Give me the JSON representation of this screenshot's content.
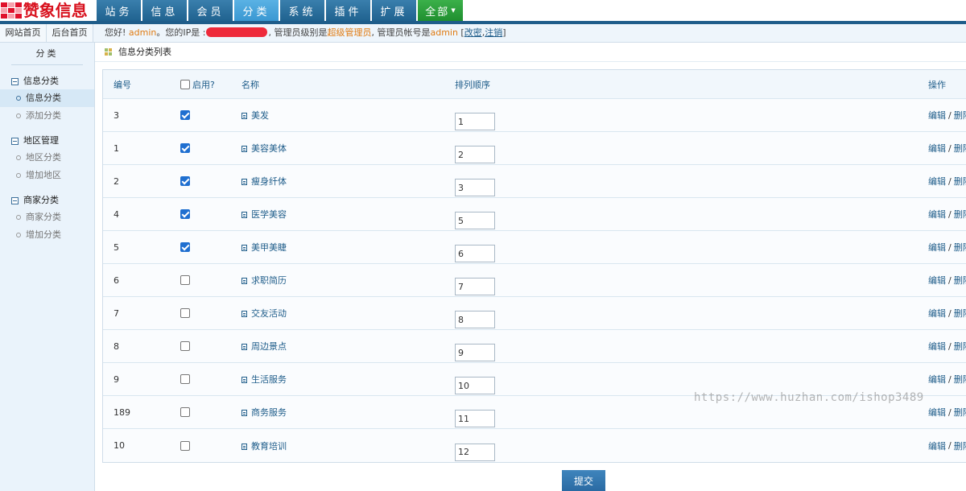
{
  "logo": {
    "text": "赞象信息"
  },
  "nav": {
    "tabs": [
      {
        "label": "站务"
      },
      {
        "label": "信息"
      },
      {
        "label": "会员"
      },
      {
        "label": "分类",
        "active": true
      },
      {
        "label": "系统"
      },
      {
        "label": "插件"
      },
      {
        "label": "扩展"
      }
    ],
    "all_label": "全部"
  },
  "quick_links": {
    "site_home": "网站首页",
    "admin_home": "后台首页"
  },
  "greeting": {
    "prefix": "您好! ",
    "user": "admin",
    "ip_label": "。您的IP是 :",
    "level_prefix": ", 管理员级别是",
    "level": "超级管理员",
    "account_prefix": ", 管理员帐号是",
    "account": "admin",
    "edit_open": " [",
    "edit_link": "改密",
    "comma": ",",
    "logout_link": "注销",
    "edit_close": "]"
  },
  "sidebar": {
    "title": "分类",
    "groups": [
      {
        "title": "信息分类",
        "items": [
          {
            "label": "信息分类",
            "active": true
          },
          {
            "label": "添加分类"
          }
        ]
      },
      {
        "title": "地区管理",
        "items": [
          {
            "label": "地区分类"
          },
          {
            "label": "增加地区"
          }
        ]
      },
      {
        "title": "商家分类",
        "items": [
          {
            "label": "商家分类"
          },
          {
            "label": "增加分类"
          }
        ]
      }
    ]
  },
  "panel": {
    "title": "信息分类列表"
  },
  "table": {
    "headers": {
      "id": "编号",
      "enabled": "启用?",
      "name": "名称",
      "order": "排列顺序",
      "ops": "操作"
    },
    "edit_label": "编辑",
    "sep": "/",
    "delete_label": "删除",
    "rows": [
      {
        "id": "3",
        "enabled": true,
        "name": "美发",
        "order": "1"
      },
      {
        "id": "1",
        "enabled": true,
        "name": "美容美体",
        "order": "2"
      },
      {
        "id": "2",
        "enabled": true,
        "name": "瘦身纤体",
        "order": "3"
      },
      {
        "id": "4",
        "enabled": true,
        "name": "医学美容",
        "order": "5"
      },
      {
        "id": "5",
        "enabled": true,
        "name": "美甲美睫",
        "order": "6"
      },
      {
        "id": "6",
        "enabled": false,
        "name": "求职简历",
        "order": "7"
      },
      {
        "id": "7",
        "enabled": false,
        "name": "交友活动",
        "order": "8"
      },
      {
        "id": "8",
        "enabled": false,
        "name": "周边景点",
        "order": "9"
      },
      {
        "id": "9",
        "enabled": false,
        "name": "生活服务",
        "order": "10"
      },
      {
        "id": "189",
        "enabled": false,
        "name": "商务服务",
        "order": "11"
      },
      {
        "id": "10",
        "enabled": false,
        "name": "教育培训",
        "order": "12"
      }
    ]
  },
  "submit_label": "提交",
  "watermark": "https://www.huzhan.com/ishop3489",
  "colors": {
    "nav": "#2a6f9e",
    "nav_active": "#4aa6dd",
    "nav_all": "#2aa13b",
    "link": "#1f5d8a",
    "accent": "#e07b12",
    "checkbox": "#1f6fd0"
  }
}
